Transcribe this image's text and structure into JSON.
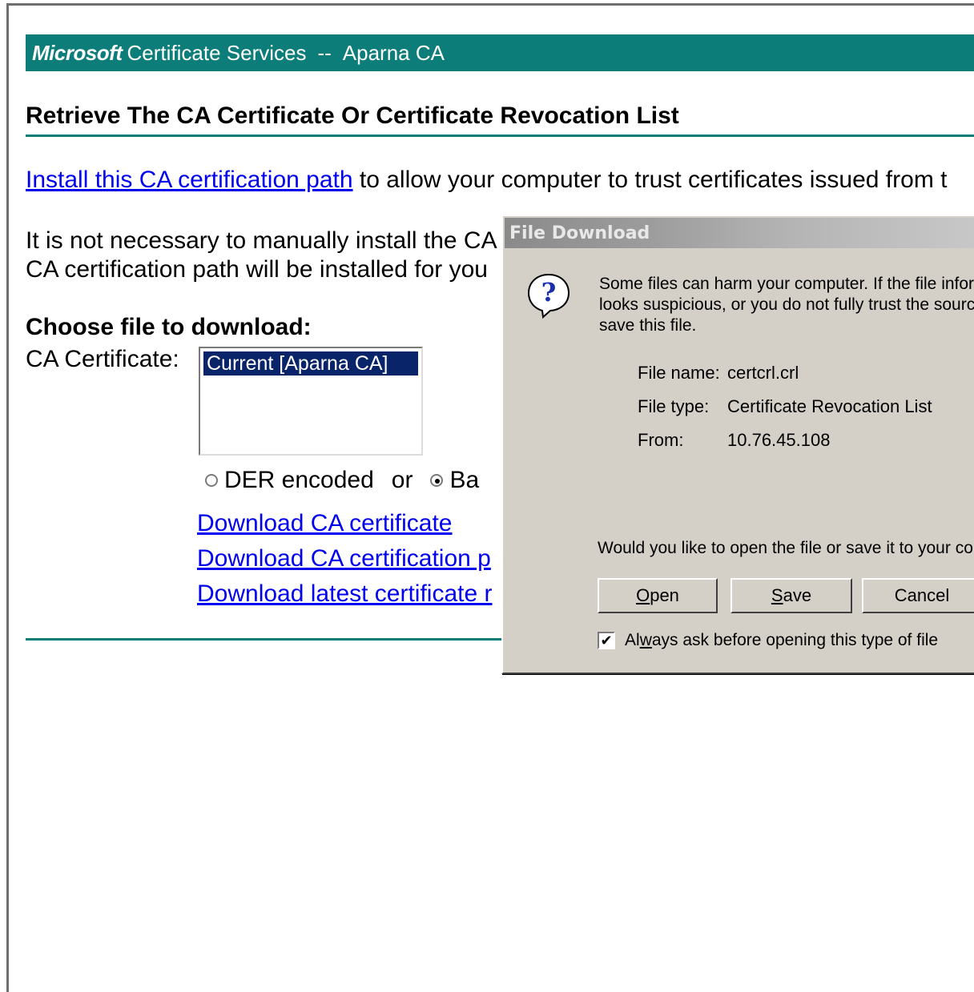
{
  "banner": {
    "brand": "Microsoft",
    "service": "Certificate Services",
    "separator": "--",
    "ca_name": "Aparna CA"
  },
  "page": {
    "title": "Retrieve The CA Certificate Or Certificate Revocation List",
    "install_link": "Install this CA certification path",
    "install_text": " to allow your computer to trust certificates issued from t",
    "note_line1": "It is not necessary to manually install the CA",
    "note_line2": "CA certification path will be installed for you",
    "choose_heading": "Choose file to download:",
    "ca_cert_label": "CA Certificate:",
    "ca_cert_options": [
      "Current [Aparna CA]"
    ],
    "encoding": {
      "der_label": "DER encoded",
      "or_label": "or",
      "base_label": "Ba",
      "selected": "base"
    },
    "links": {
      "download_ca_cert": "Download CA certificate",
      "download_ca_path": "Download CA certification p",
      "download_crl": "Download latest certificate r"
    }
  },
  "dialog": {
    "title": "File Download",
    "icon": "question-icon",
    "warning_line1": "Some files can harm your computer. If the file infor",
    "warning_line2": "looks suspicious, or you do not fully trust the sourc",
    "warning_line3": "save this file.",
    "file_name_label": "File name:",
    "file_name_value": "certcrl.crl",
    "file_type_label": "File type:",
    "file_type_value": "Certificate Revocation List",
    "from_label": "From:",
    "from_value": "10.76.45.108",
    "question": "Would you like to open the file or save it to your co",
    "open_key": "O",
    "open_rest": "pen",
    "save_key": "S",
    "save_rest": "ave",
    "cancel_label": "Cancel",
    "always_ask_pre": "Al",
    "always_ask_key": "w",
    "always_ask_post": "ays ask before opening this type of file",
    "always_ask_checked": true
  },
  "colors": {
    "banner": "#0c7d78",
    "link": "#0000ee",
    "dialog_face": "#d4d0c8",
    "selection": "#0a246a"
  }
}
